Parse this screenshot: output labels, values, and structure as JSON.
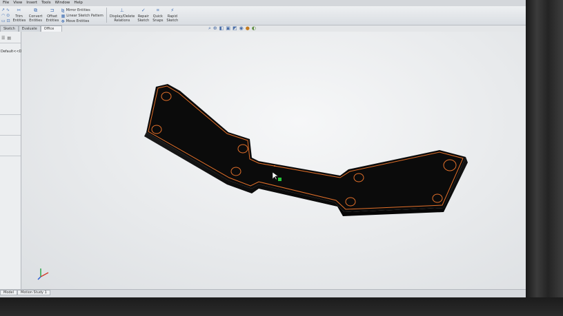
{
  "menu": [
    "File",
    "View",
    "Insert",
    "Tools",
    "Window",
    "Help"
  ],
  "toolbar": {
    "trim_label": "Trim Entities",
    "convert_label": "Convert Entities",
    "offset_label": "Offset Entities",
    "mirror_label": "Mirror Entities",
    "linear_pattern_label": "Linear Sketch Pattern",
    "move_label": "Move Entities",
    "relations_label": "Display/Delete Relations",
    "repair_label": "Repair Sketch",
    "snaps_label": "Quick Snaps",
    "rapid_label": "Rapid Sketch"
  },
  "tabs": [
    "Sketch",
    "Evaluate",
    "Office Products"
  ],
  "feature_tree": {
    "config_label": "Default<<De"
  },
  "bottom_tabs": [
    "Model",
    "Motion Study 1"
  ],
  "colors": {
    "part_body": "#0b0b0b",
    "sketch_edge": "#e3702a",
    "background": "#e8eaec",
    "origin_point": "#25c83a"
  },
  "icons": [
    "trim-icon",
    "convert-icon",
    "offset-icon",
    "mirror-icon",
    "pattern-icon",
    "move-icon",
    "relations-icon",
    "repair-icon",
    "snaps-icon",
    "rapid-sketch-icon",
    "zoom-fit-icon",
    "zoom-area-icon",
    "section-view-icon",
    "view-orientation-icon",
    "display-style-icon",
    "hide-show-icon",
    "appearance-icon",
    "scene-icon"
  ]
}
